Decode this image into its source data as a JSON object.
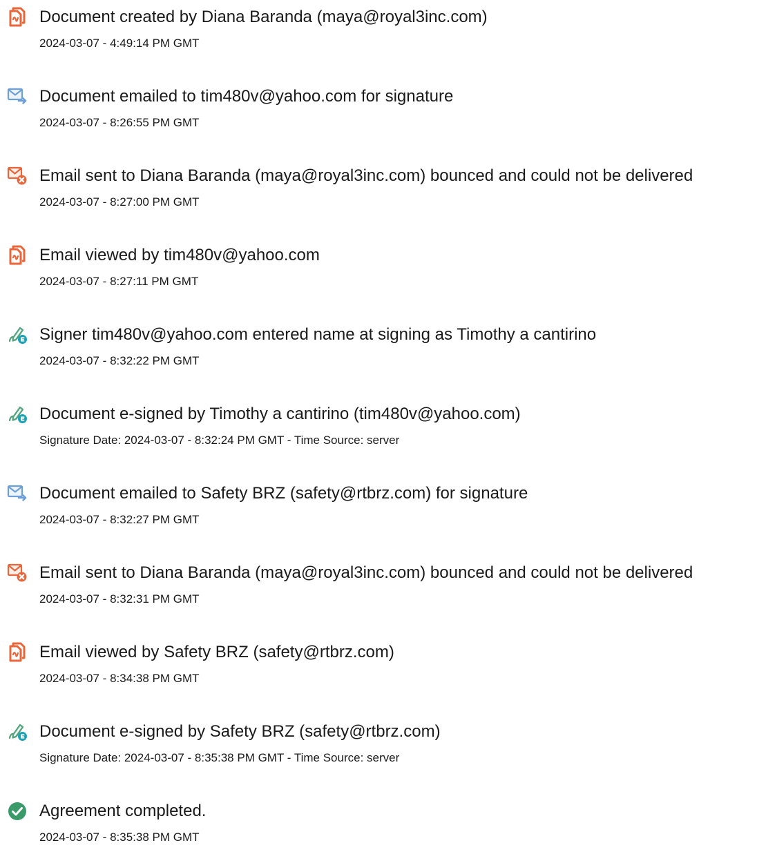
{
  "colors": {
    "doc_icon": "#e8663a",
    "mail_icon": "#6e9fd6",
    "bounce_badge": "#e8663a",
    "sign_icon": "#55a27f",
    "sign_badge": "#1ba3b5",
    "complete_icon": "#3a9a6a"
  },
  "events": [
    {
      "icon": "document-icon",
      "title": "Document created by Diana Baranda (maya@royal3inc.com)",
      "sub": "2024-03-07 - 4:49:14 PM GMT"
    },
    {
      "icon": "email-sent-icon",
      "title": "Document emailed to tim480v@yahoo.com for signature",
      "sub": "2024-03-07 - 8:26:55 PM GMT"
    },
    {
      "icon": "email-bounced-icon",
      "title": "Email sent to Diana Baranda (maya@royal3inc.com) bounced and could not be delivered",
      "sub": "2024-03-07 - 8:27:00 PM GMT"
    },
    {
      "icon": "document-icon",
      "title": "Email viewed by tim480v@yahoo.com",
      "sub": "2024-03-07 - 8:27:11 PM GMT"
    },
    {
      "icon": "esign-icon",
      "title": "Signer tim480v@yahoo.com entered name at signing as Timothy a cantirino",
      "sub": "2024-03-07 - 8:32:22 PM GMT"
    },
    {
      "icon": "esign-icon",
      "title": "Document e-signed by Timothy a cantirino (tim480v@yahoo.com)",
      "sub": "Signature Date: 2024-03-07 - 8:32:24 PM GMT - Time Source: server"
    },
    {
      "icon": "email-sent-icon",
      "title": "Document emailed to Safety BRZ (safety@rtbrz.com) for signature",
      "sub": "2024-03-07 - 8:32:27 PM GMT"
    },
    {
      "icon": "email-bounced-icon",
      "title": "Email sent to Diana Baranda (maya@royal3inc.com) bounced and could not be delivered",
      "sub": "2024-03-07 - 8:32:31 PM GMT"
    },
    {
      "icon": "document-icon",
      "title": "Email viewed by Safety BRZ (safety@rtbrz.com)",
      "sub": "2024-03-07 - 8:34:38 PM GMT"
    },
    {
      "icon": "esign-icon",
      "title": "Document e-signed by Safety BRZ (safety@rtbrz.com)",
      "sub": "Signature Date: 2024-03-07 - 8:35:38 PM GMT - Time Source: server"
    },
    {
      "icon": "checkmark-circle-icon",
      "title": "Agreement completed.",
      "sub": "2024-03-07 - 8:35:38 PM GMT"
    }
  ]
}
